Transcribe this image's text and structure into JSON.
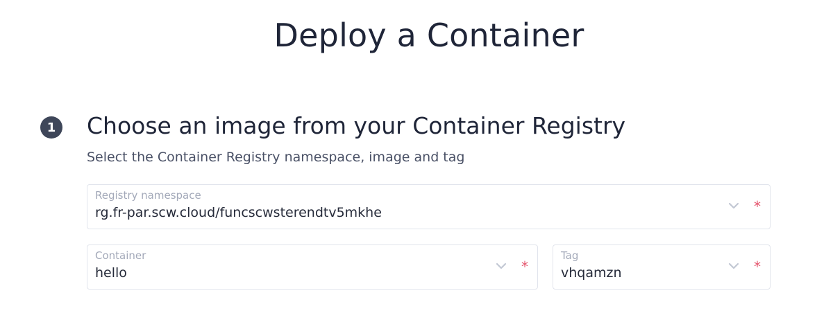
{
  "page": {
    "title": "Deploy a Container"
  },
  "step": {
    "number": "1",
    "title": "Choose an image from your Container Registry",
    "subtitle": "Select the Container Registry namespace, image and tag"
  },
  "fields": {
    "registry": {
      "label": "Registry namespace",
      "value": "rg.fr-par.scw.cloud/funcscwsterendtv5mkhe",
      "required_marker": "*"
    },
    "container": {
      "label": "Container",
      "value": "hello",
      "required_marker": "*"
    },
    "tag": {
      "label": "Tag",
      "value": "vhqamzn",
      "required_marker": "*"
    }
  },
  "colors": {
    "text_primary": "#1f2538",
    "badge_background": "#3e4659",
    "required_marker": "#e5556d",
    "field_border": "#e1e4ec",
    "label_muted": "#a3a9b9",
    "chevron": "#c3c8d4"
  },
  "icons": {
    "dropdown": "chevron-down-icon"
  }
}
